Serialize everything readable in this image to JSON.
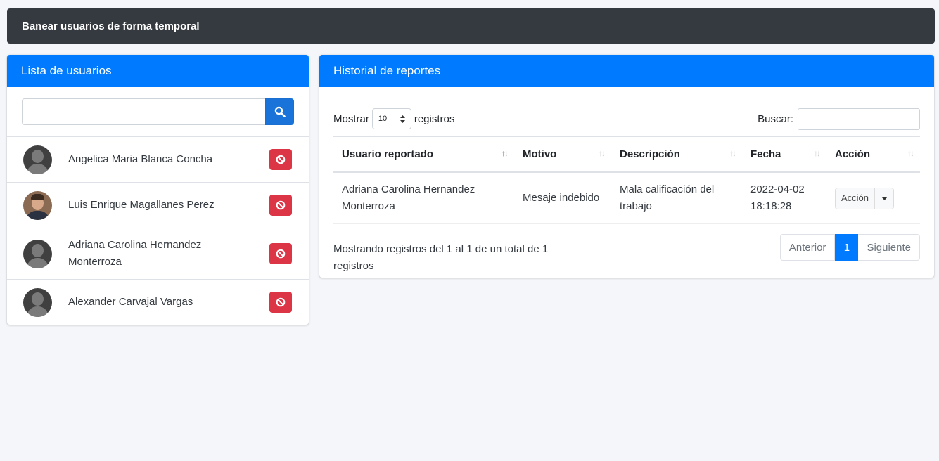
{
  "topbar": {
    "title": "Banear usuarios de forma temporal"
  },
  "users_panel": {
    "title": "Lista de usuarios",
    "search": {
      "value": "",
      "placeholder": ""
    },
    "users": [
      {
        "name": "Angelica Maria Blanca Concha",
        "avatar": "default"
      },
      {
        "name": "Luis Enrique Magallanes Perez",
        "avatar": "photo"
      },
      {
        "name": "Adriana Carolina Hernandez Monterroza",
        "avatar": "default"
      },
      {
        "name": "Alexander Carvajal Vargas",
        "avatar": "default"
      }
    ]
  },
  "reports_panel": {
    "title": "Historial de reportes",
    "length": {
      "prefix": "Mostrar",
      "value": "10",
      "suffix": "registros"
    },
    "search_label": "Buscar:",
    "columns": [
      "Usuario reportado",
      "Motivo",
      "Descripción",
      "Fecha",
      "Acción"
    ],
    "rows": [
      {
        "user": "Adriana Carolina Hernandez Monterroza",
        "reason": "Mesaje indebido",
        "description": "Mala calificación del trabajo",
        "date": "2022-04-02 18:18:28",
        "action": "Acción"
      }
    ],
    "info": "Mostrando registros del 1 al 1 de un total de 1 registros",
    "pagination": {
      "prev": "Anterior",
      "current": "1",
      "next": "Siguiente"
    }
  },
  "colors": {
    "primary": "#007bff",
    "danger": "#dc3545",
    "dark": "#343a40"
  },
  "icons": {
    "search": "search-icon",
    "ban": "ban-icon",
    "caret": "caret-down-icon"
  }
}
